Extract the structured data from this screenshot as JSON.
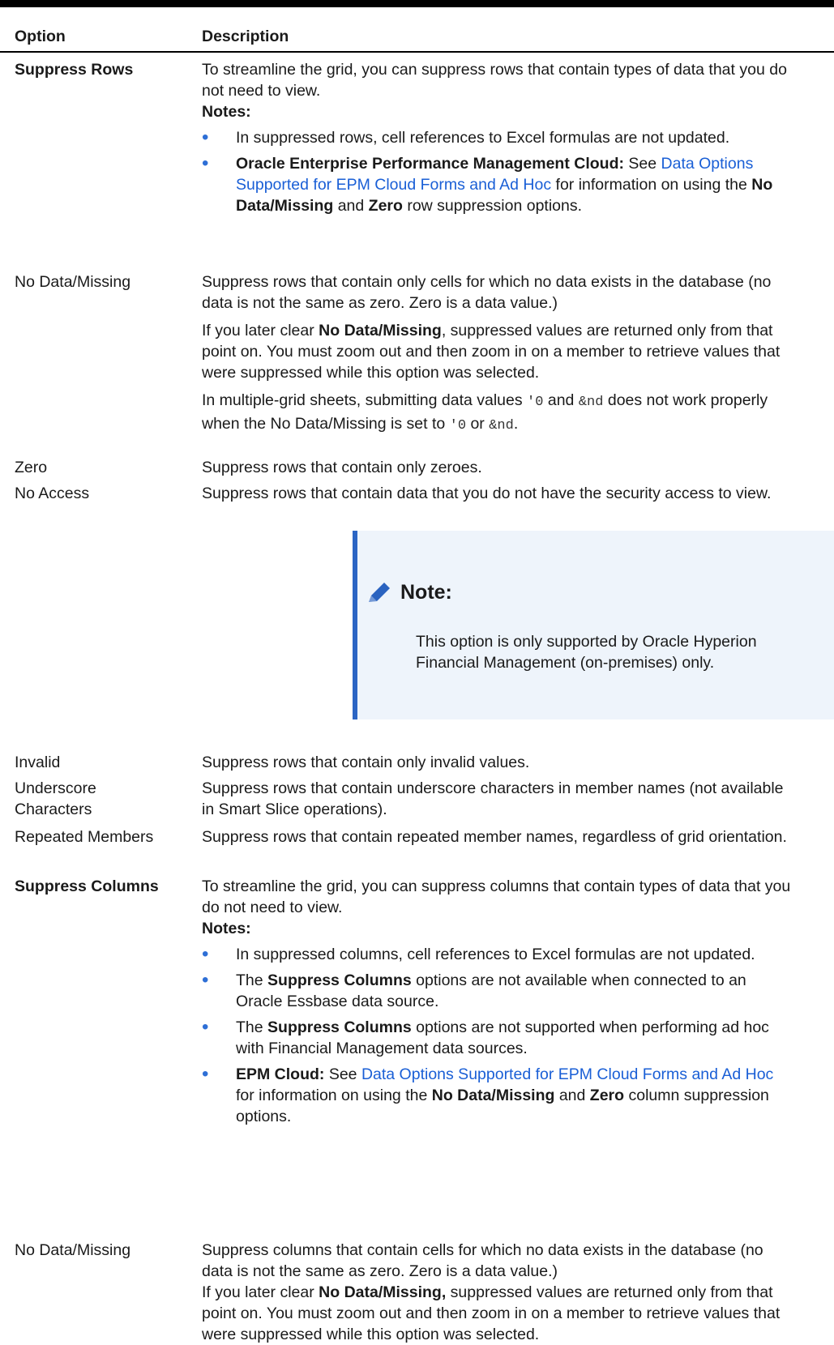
{
  "header": {
    "option": "Option",
    "description": "Description"
  },
  "suppress_rows": {
    "option": "Suppress Rows",
    "intro": "To streamline the grid, you can suppress rows that contain types of data that you do not need to view.",
    "notes_label": "Notes:",
    "bullet1": "In suppressed rows, cell references to Excel formulas are not updated.",
    "bullet2": {
      "bold": "Oracle Enterprise Performance Management Cloud:",
      "see": " See ",
      "link": "Data Options Supported for EPM Cloud Forms and Ad Hoc",
      "for_info": " for information on using the ",
      "b1": "No Data/Missing",
      "and": " and ",
      "b2": "Zero",
      "tail": " row suppression options."
    }
  },
  "no_data_rows": {
    "option": "No Data/Missing",
    "p1": "Suppress rows that contain only cells for which no data exists in the database (no data is not the same as zero. Zero is a data value.)",
    "p2_pre": "If you later clear ",
    "p2_bold": "No Data/Missing",
    "p2_post": ", suppressed values are returned only from that point on. You must zoom out and then zoom in on a member to retrieve values that were suppressed while this option was selected.",
    "p3_a": "In multiple-grid sheets, submitting data values ",
    "p3_code1": "'0",
    "p3_b": " and ",
    "p3_code2": "&nd",
    "p3_c": " does not work properly when the No Data/Missing is set to ",
    "p3_code3": "'0",
    "p3_d": " or ",
    "p3_code4": "&nd",
    "p3_e": "."
  },
  "zero": {
    "option": "Zero",
    "desc": "Suppress rows that contain only zeroes."
  },
  "no_access": {
    "option": "No Access",
    "desc": "Suppress rows that contain data that you do not have the security access to view."
  },
  "note": {
    "title": "Note:",
    "icon": "pencil-icon",
    "text": "This option is only supported by Oracle Hyperion Financial Management (on-premises) only."
  },
  "invalid": {
    "option": "Invalid",
    "desc": "Suppress rows that contain only invalid values."
  },
  "underscore": {
    "option": "Underscore Characters",
    "desc": "Suppress rows that contain underscore characters in member names (not available in Smart Slice operations)."
  },
  "repeated": {
    "option": "Repeated Members",
    "desc": "Suppress rows that contain repeated member names, regardless of grid orientation."
  },
  "suppress_columns": {
    "option": "Suppress Columns",
    "intro": "To streamline the grid, you can suppress columns that contain types of data that you do not need to view.",
    "notes_label": "Notes:",
    "bullet1": "In suppressed columns, cell references to Excel formulas are not updated.",
    "bullet2": {
      "pre": "The ",
      "bold": "Suppress Columns",
      "post": " options are not available when connected to an Oracle Essbase data source."
    },
    "bullet3": {
      "pre": "The ",
      "bold": "Suppress Columns",
      "post": " options are not supported when performing ad hoc with Financial Management data sources."
    },
    "bullet4": {
      "bold": "EPM Cloud:",
      "see": " See ",
      "link": "Data Options Supported for EPM Cloud Forms and Ad Hoc",
      "for_info": " for information on using the ",
      "b1": "No Data/Missing",
      "and": " and ",
      "b2": "Zero",
      "tail": " column suppression options."
    }
  },
  "no_data_cols": {
    "option": "No Data/Missing",
    "p1": "Suppress columns that contain cells for which no data exists in the database (no data is not the same as zero. Zero is a data value.)",
    "p2_pre": "If you later clear ",
    "p2_bold": "No Data/Missing,",
    "p2_post": " suppressed values are returned only from that point on. You must zoom out and then zoom in on a member to retrieve values that were suppressed while this option was selected."
  }
}
